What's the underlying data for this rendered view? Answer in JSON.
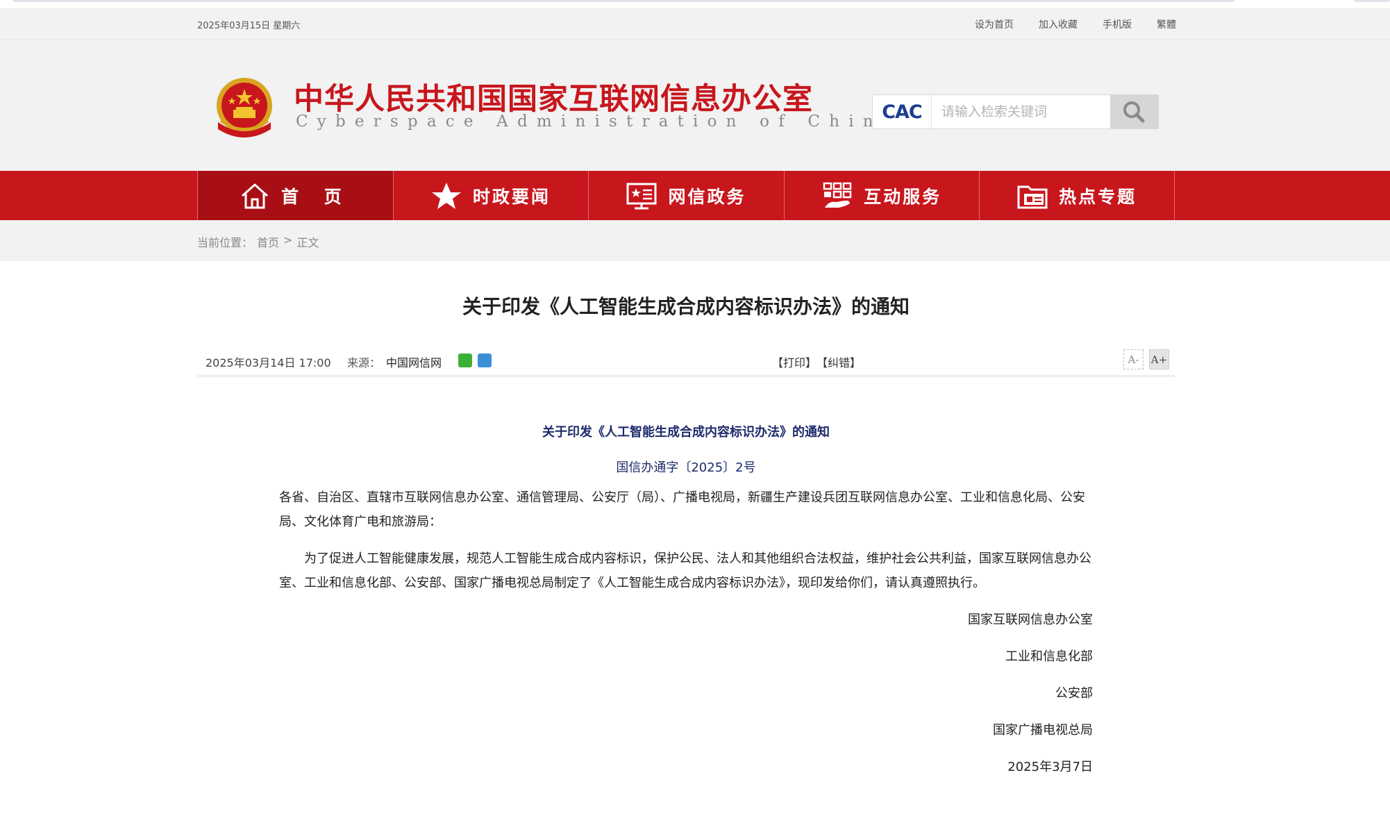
{
  "topbar": {
    "date": "2025年03月15日 星期六",
    "links": [
      "设为首页",
      "加入收藏",
      "手机版",
      "繁體"
    ]
  },
  "header": {
    "title_cn": "中华人民共和国国家互联网信息办公室",
    "title_en": "Cyberspace Administration of China",
    "search_logo": "CAC",
    "search_placeholder": "请输入检索关键词"
  },
  "nav": {
    "items": [
      {
        "label": "首 页",
        "icon": "home-icon"
      },
      {
        "label": "时政要闻",
        "icon": "star-icon"
      },
      {
        "label": "网信政务",
        "icon": "screen-star-icon"
      },
      {
        "label": "互动服务",
        "icon": "hand-grid-icon"
      },
      {
        "label": "热点专题",
        "icon": "folder-icon"
      }
    ]
  },
  "breadcrumb": {
    "label": "当前位置：",
    "home": "首页",
    "sep": ">",
    "current": "正文"
  },
  "article": {
    "title": "关于印发《人工智能生成合成内容标识办法》的通知",
    "time": "2025年03月14日 17:00",
    "source_label": "来源：",
    "source": "中国网信网",
    "print": "【打印】",
    "correct": "【纠错】",
    "font_smaller": "A-",
    "font_larger": "A+",
    "doc_title": "关于印发《人工智能生成合成内容标识办法》的通知",
    "doc_no": "国信办通字〔2025〕2号",
    "addressee": "各省、自治区、直辖市互联网信息办公室、通信管理局、公安厅（局）、广播电视局，新疆生产建设兵团互联网信息办公室、工业和信息化局、公安局、文化体育广电和旅游局：",
    "body": "为了促进人工智能健康发展，规范人工智能生成合成内容标识，保护公民、法人和其他组织合法权益，维护社会公共利益，国家互联网信息办公室、工业和信息化部、公安部、国家广播电视总局制定了《人工智能生成合成内容标识办法》，现印发给你们，请认真遵照执行。",
    "signatories": [
      "国家互联网信息办公室",
      "工业和信息化部",
      "公安部",
      "国家广播电视总局"
    ],
    "doc_date": "2025年3月7日"
  },
  "colors": {
    "brand_red": "#c8161d",
    "nav_active": "#a80f14",
    "doc_blue": "#1e2a6b"
  }
}
